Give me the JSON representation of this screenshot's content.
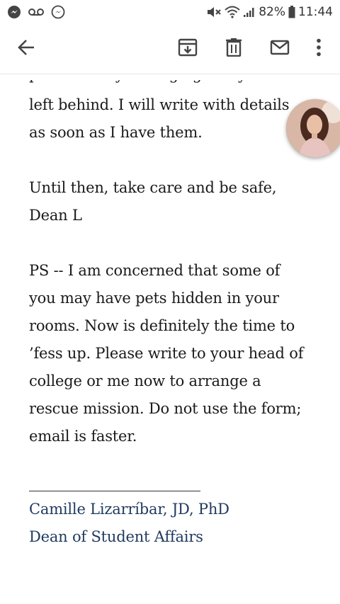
{
  "status_bar": {
    "battery": "82%",
    "time": "11:44"
  },
  "toolbar": {
    "back_icon": "arrow-left-icon",
    "archive_icon": "archive-icon",
    "delete_icon": "trash-icon",
    "mark_unread_icon": "envelope-icon",
    "more_icon": "more-vertical-icon"
  },
  "message": {
    "partial_top_line": "pets and any belongings they were",
    "lines_p1": [
      "left behind. I will write with details",
      "as soon as I have them."
    ],
    "lines_p2": [
      "Until then, take care and be safe,",
      "Dean L"
    ],
    "lines_p3": [
      "PS -- I am concerned that some of",
      "you may have pets hidden in your",
      "rooms. Now is definitely the time to",
      "’fess up. Please write to your head of",
      "college or me now to arrange a",
      "rescue mission. Do not use the form;",
      "email is faster."
    ]
  },
  "signature": {
    "name": "Camille Lizarríbar, JD, PhD",
    "title": "Dean of Student Affairs"
  },
  "colors": {
    "signature": "#1f3a5f",
    "body_text": "#1a1a1a"
  }
}
